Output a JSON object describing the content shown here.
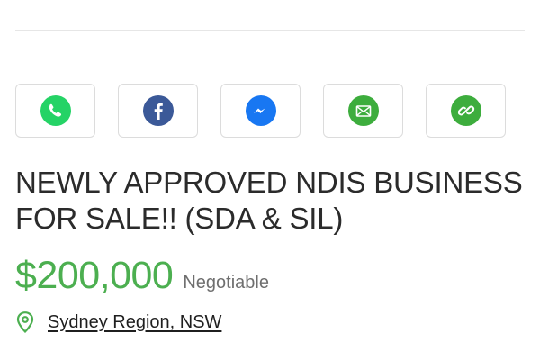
{
  "share": {
    "buttons": [
      {
        "name": "whatsapp",
        "icon": "whatsapp-icon",
        "color": "#25D366"
      },
      {
        "name": "facebook",
        "icon": "facebook-icon",
        "color": "#3b5998"
      },
      {
        "name": "messenger",
        "icon": "messenger-icon",
        "color": "#1877F2"
      },
      {
        "name": "email",
        "icon": "email-icon",
        "color": "#3dad3d"
      },
      {
        "name": "copy-link",
        "icon": "link-icon",
        "color": "#3dad3d"
      }
    ]
  },
  "listing": {
    "title": "NEWLY APPROVED NDIS BUSINESS FOR SALE!! (SDA & SIL)",
    "price": "$200,000",
    "price_note": "Negotiable",
    "location": "Sydney Region, NSW",
    "location_icon": "location-pin-icon",
    "price_color": "#4caf50"
  }
}
